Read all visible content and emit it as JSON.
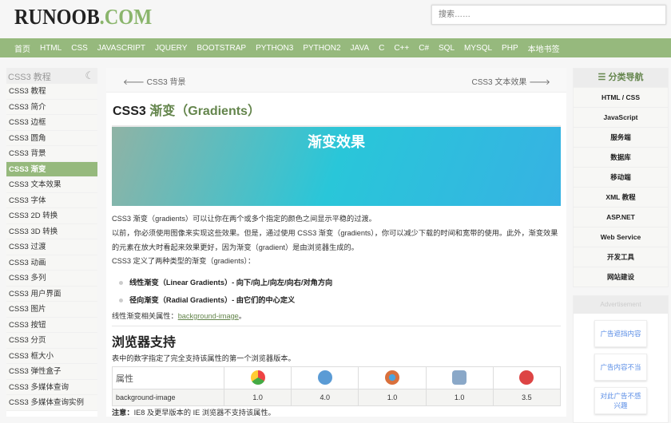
{
  "header": {
    "logo_main": "RUNOOB",
    "logo_suffix": ".COM",
    "search_placeholder": "搜索……"
  },
  "nav": [
    "首页",
    "HTML",
    "CSS",
    "JAVASCRIPT",
    "JQUERY",
    "BOOTSTRAP",
    "PYTHON3",
    "PYTHON2",
    "JAVA",
    "C",
    "C++",
    "C#",
    "SQL",
    "MYSQL",
    "PHP",
    "本地书签"
  ],
  "left_sidebar": {
    "title": "CSS3 教程",
    "items": [
      "CSS3 教程",
      "CSS3 简介",
      "CSS3 边框",
      "CSS3 圆角",
      "CSS3 背景",
      "CSS3 渐变",
      "CSS3 文本效果",
      "CSS3 字体",
      "CSS3 2D 转换",
      "CSS3 3D 转换",
      "CSS3 过渡",
      "CSS3 动画",
      "CSS3 多列",
      "CSS3 用户界面",
      "CSS3 图片",
      "CSS3 按钮",
      "CSS3 分页",
      "CSS3 框大小",
      "CSS3 弹性盒子",
      "CSS3 多媒体查询",
      "CSS3 多媒体查询实例"
    ],
    "active_index": 5
  },
  "main": {
    "prev": "CSS3 背景",
    "next": "CSS3 文本效果",
    "title_prefix": "CSS3",
    "title_main": "渐变（Gradients）",
    "banner": "渐变效果",
    "p1": "CSS3 渐变（gradients）可以让你在两个或多个指定的颜色之间显示平稳的过渡。",
    "p2": "以前，你必须使用图像来实现这些效果。但是，通过使用 CSS3 渐变（gradients），你可以减少下载的时间和宽带的使用。此外，渐变效果的元素在放大时看起来效果更好，因为渐变（gradient）是由浏览器生成的。",
    "p3": "CSS3 定义了两种类型的渐变（gradients）：",
    "list": [
      "线性渐变（Linear Gradients）- 向下/向上/向左/向右/对角方向",
      "径向渐变（Radial Gradients）- 由它们的中心定义"
    ],
    "related_label": "线性渐变相关属性：",
    "related_link": "background-image",
    "related_end": "。",
    "h2": "浏览器支持",
    "table_desc": "表中的数字指定了完全支持该属性的第一个浏览器版本。",
    "table": {
      "header": "属性",
      "browsers": [
        "chrome",
        "ie",
        "firefox",
        "safari",
        "opera"
      ],
      "rows": [
        {
          "prop": "background-image",
          "values": [
            "1.0",
            "4.0",
            "1.0",
            "1.0",
            "3.5"
          ]
        }
      ]
    },
    "note_bold": "注意：",
    "note": "IE8 及更早版本的 IE 浏览器不支持该属性。"
  },
  "right_sidebar": {
    "title": "分类导航",
    "items": [
      "HTML / CSS",
      "JavaScript",
      "服务端",
      "数据库",
      "移动端",
      "XML 教程",
      "ASP.NET",
      "Web Service",
      "开发工具",
      "网站建设"
    ],
    "ad_title": "Advertisement",
    "ad_buttons": [
      "广告遮挡内容",
      "广告内容不当",
      "对此广告不感兴趣"
    ]
  },
  "colors": {
    "brand": "#96b97d",
    "title_green": "#64854c"
  }
}
